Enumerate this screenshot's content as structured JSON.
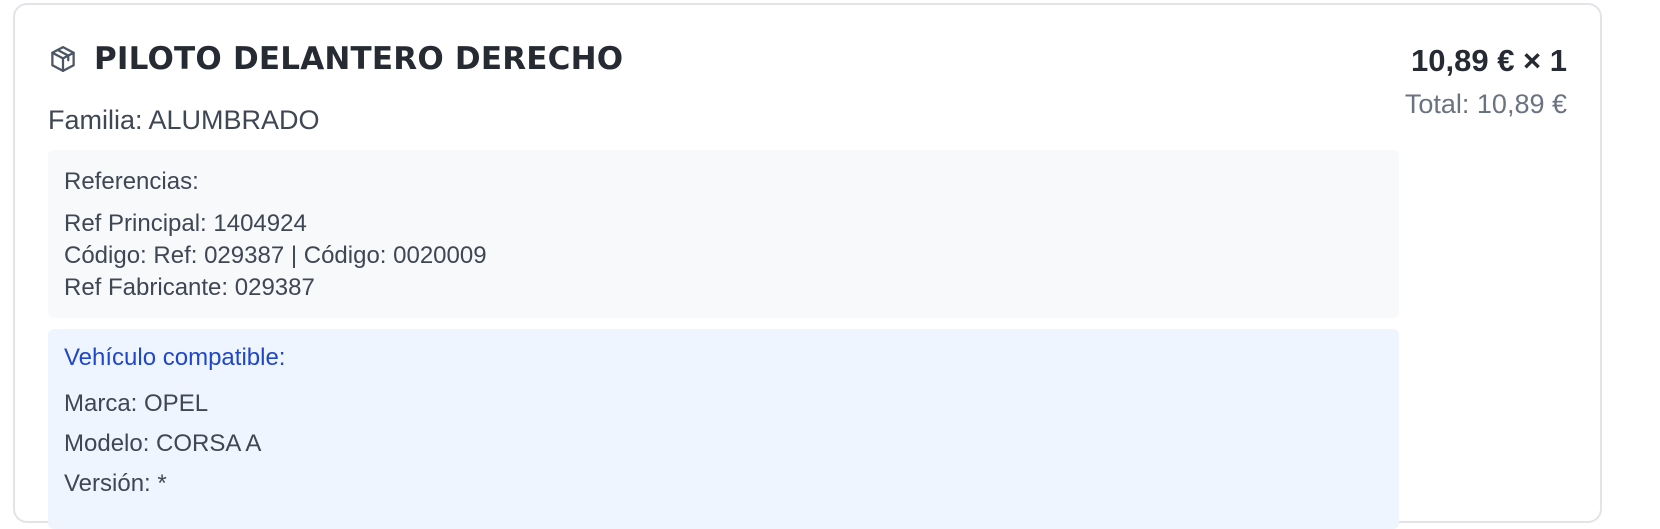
{
  "product": {
    "icon": "package-icon",
    "title": "PILOTO DELANTERO DERECHO",
    "familia": "Familia: ALUMBRADO",
    "price": "10,89 € × 1",
    "total": "Total: 10,89 €"
  },
  "references": {
    "heading": "Referencias:",
    "lines": [
      "Ref Principal: 1404924",
      "Código: Ref: 029387 | Código: 0020009",
      "Ref Fabricante: 029387"
    ]
  },
  "vehicle": {
    "heading": "Vehículo compatible:",
    "lines": [
      "Marca: OPEL",
      "Modelo: CORSA A",
      "Versión: *"
    ]
  },
  "colors": {
    "accent_blue": "#1f47c7",
    "vehicle_bg": "#eff5fe",
    "refs_bg": "#f8f9fb",
    "border": "#e2e4e8"
  }
}
